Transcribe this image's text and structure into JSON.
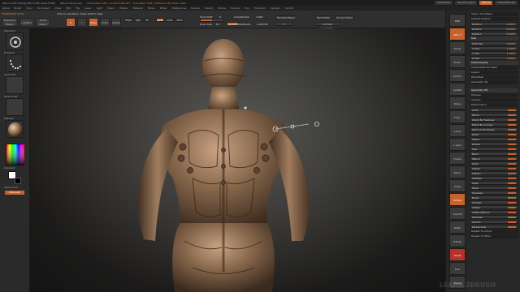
{
  "titlebar": {
    "app": "ZBrush 4R6 P2(64)[AMD-VCDE-LEQG-XFBE]",
    "document": "ZBrush Document",
    "mesh_info": "Active Mem 443 • Scratch Disk 917 • Free Mem 7318 • ZTime 2.746 Timer 0.441",
    "buttons": [
      "QuickSave",
      "See-through 0",
      "Menus",
      "DefaultZScript"
    ]
  },
  "menubar": {
    "items": [
      "Alpha",
      "Brush",
      "Color",
      "Document",
      "Draw",
      "Edit",
      "File",
      "Layer",
      "Light",
      "Macro",
      "Marker",
      "Material",
      "Movie",
      "Picker",
      "Preferences",
      "Render",
      "Stencil",
      "Stroke",
      "Texture",
      "Tool",
      "Transform",
      "Zplugin",
      "Zscript"
    ]
  },
  "shelf": {
    "notice": "TRANSPOSE LOCK:",
    "hint": "Click to reposition. Press shift to align.",
    "projection_master": "Projection Master",
    "lightbox": "LightBox",
    "quick_sketch": "Quick Sketch",
    "move": "Move",
    "scale": "Scale",
    "rotate": "Rotate",
    "mrgb": "Mrgb",
    "rgb": "Rgb",
    "m": "M",
    "zadd": "Zadd",
    "zsub": "Zsub",
    "zcut": "Zcut",
    "focal_shift_label": "Focal Shift",
    "focal_shift": "0",
    "draw_size_label": "Draw Size",
    "draw_size": "64",
    "dynamic": "Dynamic",
    "active_points_label": "ActivePoints:",
    "active_points": "1,825",
    "total_points_label": "TotalPoints:",
    "total_points": "4.678 Mil",
    "backface_mask": "BackfaceMask",
    "backface_mask_value": "0",
    "dot_rgb_label": "Del Hidden",
    "group_visible": "Group Visible",
    "activate_symmetry": "Activate Symmetry"
  },
  "left_tray": {
    "brush_label": "Standard",
    "stroke_label": "DragDot",
    "alpha_label": "Alpha Off",
    "texture_label": "Texture Off",
    "material_label": "MatCap",
    "gradient_label": "Gradient",
    "switch_color_label": "SwitchColor",
    "alternate_label": "Alternate"
  },
  "right_tray": {
    "buttons": [
      "BPR",
      "SPix 3",
      "Scroll",
      "Zoom",
      "Actual",
      "AAHalf",
      "Persp",
      "Floor",
      "Local",
      "L.Sym",
      "Frame",
      "Move",
      "Scale",
      "Rotate",
      "Line Fill",
      "PolyF",
      "Transp",
      "Ghost",
      "Solo",
      "Xpose"
    ]
  },
  "panel": {
    "items": [
      {
        "label": "Geometry HD",
        "kind": "hdr"
      },
      {
        "label": "Preview",
        "kind": "grp"
      },
      {
        "label": "Surface",
        "kind": "grp"
      },
      {
        "label": "Deformation",
        "kind": "grp"
      },
      {
        "label": "Unify",
        "kind": "sld"
      },
      {
        "label": "Mirror",
        "kind": "sld"
      },
      {
        "label": "Polish By Features",
        "kind": "sld"
      },
      {
        "label": "Polish By Groups",
        "kind": "sld"
      },
      {
        "label": "Polish Crisp Edges",
        "kind": "sld"
      },
      {
        "label": "Relax",
        "kind": "sld"
      },
      {
        "label": "Offset",
        "kind": "sld"
      },
      {
        "label": "Rotate",
        "kind": "sld"
      },
      {
        "label": "Size",
        "kind": "sld"
      },
      {
        "label": "Bend",
        "kind": "sld"
      },
      {
        "label": "SBend",
        "kind": "sld"
      },
      {
        "label": "Skew",
        "kind": "sld"
      },
      {
        "label": "SSkew",
        "kind": "sld"
      },
      {
        "label": "Flatten",
        "kind": "sld"
      },
      {
        "label": "SFlatten",
        "kind": "sld"
      },
      {
        "label": "Twist",
        "kind": "sld"
      },
      {
        "label": "Taper",
        "kind": "sld"
      },
      {
        "label": "Squeeze",
        "kind": "sld"
      },
      {
        "label": "Noise",
        "kind": "sld"
      },
      {
        "label": "Smooth",
        "kind": "sld"
      },
      {
        "label": "Inflate",
        "kind": "sld"
      },
      {
        "label": "Inflate Balloon",
        "kind": "sld"
      },
      {
        "label": "Spherize",
        "kind": "sld"
      },
      {
        "label": "Gravity",
        "kind": "sld"
      },
      {
        "label": "Perspective",
        "kind": "sld"
      },
      {
        "label": "Repeat To Active",
        "kind": "grp"
      },
      {
        "label": "Repeat To Other",
        "kind": "grp"
      }
    ],
    "top_items": [
      {
        "label": "Vector And Wiper",
        "kind": "grp"
      },
      {
        "label": "Subtool Position",
        "kind": "grp"
      },
      {
        "label": "Position",
        "value": "0.0000",
        "kind": "sld"
      },
      {
        "label": "Position",
        "value": "0.0000",
        "kind": "sld"
      },
      {
        "label": "Position",
        "value": "0.0000",
        "kind": "sld"
      },
      {
        "label": "Size",
        "kind": "hdr"
      },
      {
        "label": "XYZ Size",
        "value": "1.0000",
        "kind": "sld"
      },
      {
        "label": "X Size",
        "value": "1.0000",
        "kind": "sld"
      },
      {
        "label": "Y Size",
        "value": "1.0000",
        "kind": "sld"
      },
      {
        "label": "Z Size",
        "value": "1.0000",
        "kind": "sld"
      },
      {
        "label": "MeshIntegrity",
        "kind": "hdr"
      },
      {
        "label": "Check Mesh Fix Mesh",
        "kind": "grp"
      },
      {
        "label": "Layers",
        "kind": "grp"
      },
      {
        "label": "FiberMesh",
        "kind": "grp"
      },
      {
        "label": "Geometry 3D",
        "kind": "grp"
      }
    ]
  },
  "watermark": "LEARN ZBRUSH",
  "colors": {
    "accent": "#c8612a",
    "background": "#2b2b2b",
    "model": "#8a6a4e"
  }
}
